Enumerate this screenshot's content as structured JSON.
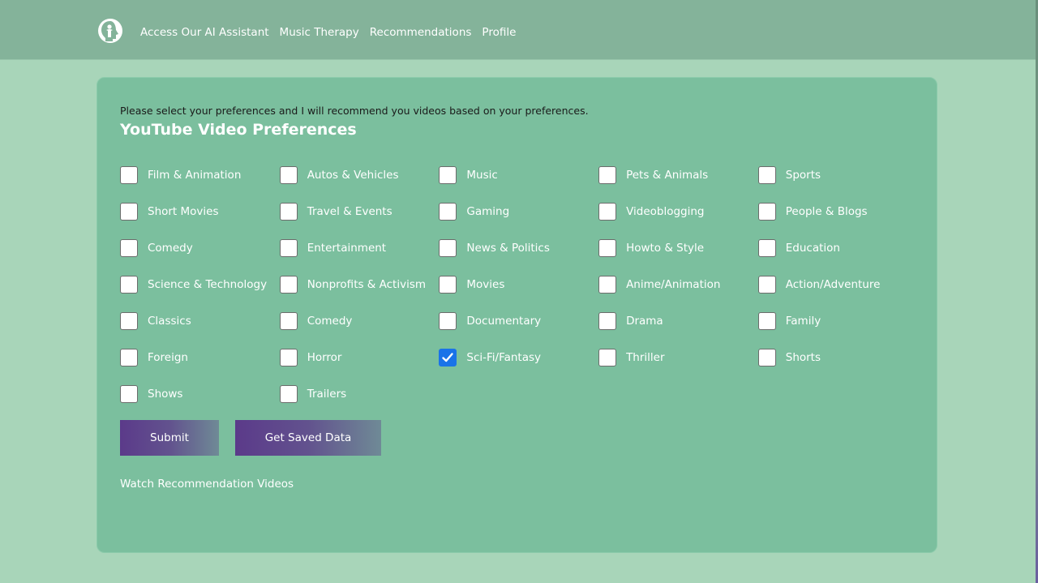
{
  "nav": {
    "items": [
      "Access Our AI Assistant",
      "Music Therapy",
      "Recommendations",
      "Profile"
    ]
  },
  "page": {
    "intro": "Please select your preferences and I will recommend you videos based on your preferences.",
    "title": "YouTube Video Preferences"
  },
  "preferences": [
    {
      "label": "Film & Animation",
      "checked": false
    },
    {
      "label": "Autos & Vehicles",
      "checked": false
    },
    {
      "label": "Music",
      "checked": false
    },
    {
      "label": "Pets & Animals",
      "checked": false
    },
    {
      "label": "Sports",
      "checked": false
    },
    {
      "label": "Short Movies",
      "checked": false
    },
    {
      "label": "Travel & Events",
      "checked": false
    },
    {
      "label": "Gaming",
      "checked": false
    },
    {
      "label": "Videoblogging",
      "checked": false
    },
    {
      "label": "People & Blogs",
      "checked": false
    },
    {
      "label": "Comedy",
      "checked": false
    },
    {
      "label": "Entertainment",
      "checked": false
    },
    {
      "label": "News & Politics",
      "checked": false
    },
    {
      "label": "Howto & Style",
      "checked": false
    },
    {
      "label": "Education",
      "checked": false
    },
    {
      "label": "Science & Technology",
      "checked": false
    },
    {
      "label": "Nonprofits & Activism",
      "checked": false
    },
    {
      "label": "Movies",
      "checked": false
    },
    {
      "label": "Anime/Animation",
      "checked": false
    },
    {
      "label": "Action/Adventure",
      "checked": false
    },
    {
      "label": "Classics",
      "checked": false
    },
    {
      "label": "Comedy",
      "checked": false
    },
    {
      "label": "Documentary",
      "checked": false
    },
    {
      "label": "Drama",
      "checked": false
    },
    {
      "label": "Family",
      "checked": false
    },
    {
      "label": "Foreign",
      "checked": false
    },
    {
      "label": "Horror",
      "checked": false
    },
    {
      "label": "Sci-Fi/Fantasy",
      "checked": true
    },
    {
      "label": "Thriller",
      "checked": false
    },
    {
      "label": "Shorts",
      "checked": false
    },
    {
      "label": "Shows",
      "checked": false
    },
    {
      "label": "Trailers",
      "checked": false
    }
  ],
  "buttons": {
    "submit": "Submit",
    "saved": "Get Saved Data"
  },
  "links": {
    "watch": "Watch Recommendation Videos"
  },
  "colors": {
    "header": "#84b39a",
    "background": "#a8d5b9",
    "card": "#7bbf9e",
    "checkbox_checked": "#1a73e8"
  },
  "icons": {
    "logo": "head-person-logo-icon",
    "check": "checkmark-icon"
  }
}
